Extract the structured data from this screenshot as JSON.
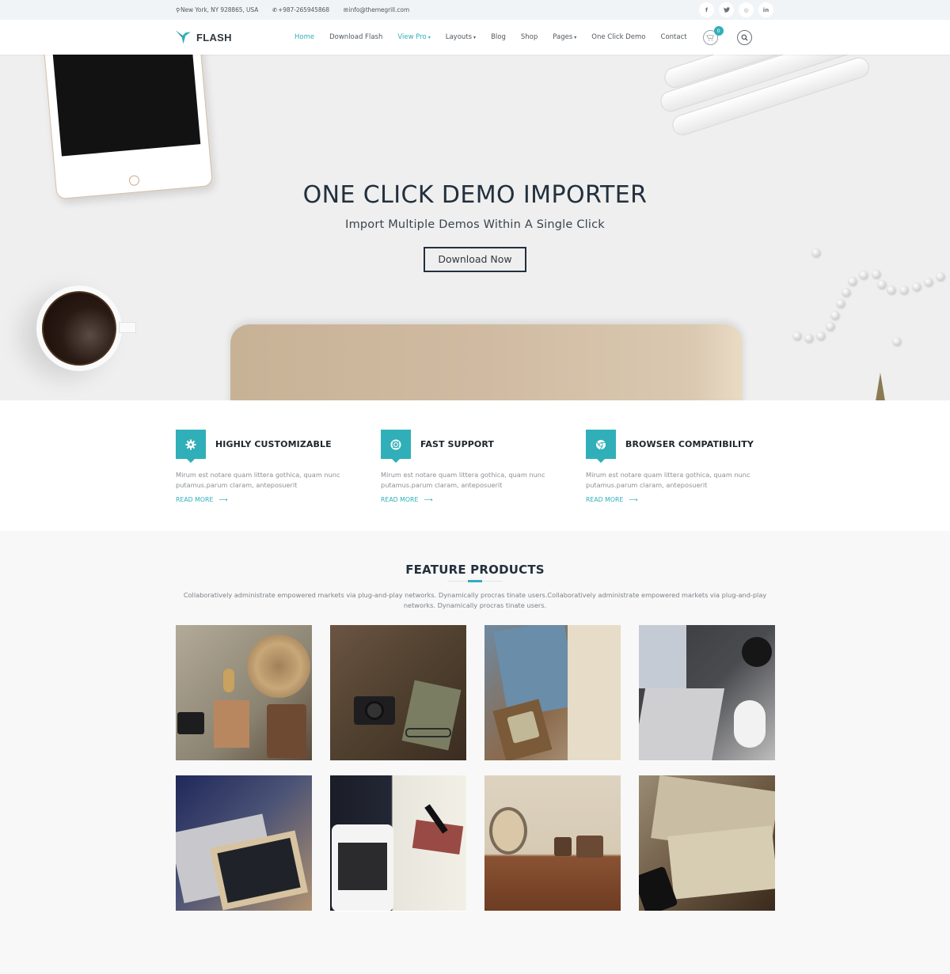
{
  "topbar": {
    "address": "New York, NY 928865, USA",
    "phone": "+987-265945868",
    "email": "info@themegrill.com",
    "socials": [
      {
        "name": "facebook",
        "glyph": "f"
      },
      {
        "name": "twitter",
        "glyph": "t"
      },
      {
        "name": "instagram",
        "glyph": "◎"
      },
      {
        "name": "linkedin",
        "glyph": "in"
      }
    ]
  },
  "header": {
    "logo_text": "FLASH",
    "nav": [
      {
        "label": "Home",
        "active": true,
        "dropdown": false
      },
      {
        "label": "Download Flash",
        "active": false,
        "dropdown": false
      },
      {
        "label": "View Pro",
        "active": true,
        "dropdown": true
      },
      {
        "label": "Layouts",
        "active": false,
        "dropdown": true
      },
      {
        "label": "Blog",
        "active": false,
        "dropdown": false
      },
      {
        "label": "Shop",
        "active": false,
        "dropdown": false
      },
      {
        "label": "Pages",
        "active": false,
        "dropdown": true
      },
      {
        "label": "One Click Demo",
        "active": false,
        "dropdown": false
      },
      {
        "label": "Contact",
        "active": false,
        "dropdown": false
      }
    ],
    "cart_count": "0",
    "chevron": "⌄"
  },
  "hero": {
    "title": "ONE CLICK DEMO IMPORTER",
    "subtitle": "Import Multiple Demos Within A Single Click",
    "button_label": "Download Now"
  },
  "features": [
    {
      "title": "HIGHLY CUSTOMIZABLE",
      "icon": "gear-icon",
      "description": "Mirum est notare quam littera gothica, quam nunc putamus.parum claram, anteposuerit",
      "link_label": "READ MORE"
    },
    {
      "title": "FAST SUPPORT",
      "icon": "lifebuoy-icon",
      "description": "Mirum est notare quam littera gothica, quam nunc putamus.parum claram, anteposuerit",
      "link_label": "READ MORE"
    },
    {
      "title": "BROWSER COMPATIBILITY",
      "icon": "chrome-icon",
      "description": "Mirum est notare quam littera gothica, quam nunc putamus.parum claram, anteposuerit",
      "link_label": "READ MORE"
    }
  ],
  "products": {
    "title": "FEATURE PRODUCTS",
    "description": "Collaboratively administrate empowered markets via plug-and-play networks. Dynamically procras tinate users.Collaboratively administrate empowered markets via plug-and-play networks. Dynamically procras tinate users.",
    "items": [
      {
        "subject": "travel flat-lay with sandals, hat, camera"
      },
      {
        "subject": "camera and notebook on wood"
      },
      {
        "subject": "glasses, book and clock"
      },
      {
        "subject": "laptop, watch, mouse and coffee"
      },
      {
        "subject": "laptop with chalkboard apple"
      },
      {
        "subject": "phone with earphones and card"
      },
      {
        "subject": "alarm clock on carved shelf"
      },
      {
        "subject": "open book with glasses and phone"
      }
    ]
  },
  "colors": {
    "accent": "#30afb8",
    "heading": "#23303d",
    "topbar_bg": "#f1f4f7",
    "hero_bg": "#efefef",
    "products_bg": "#f8f8f8"
  }
}
